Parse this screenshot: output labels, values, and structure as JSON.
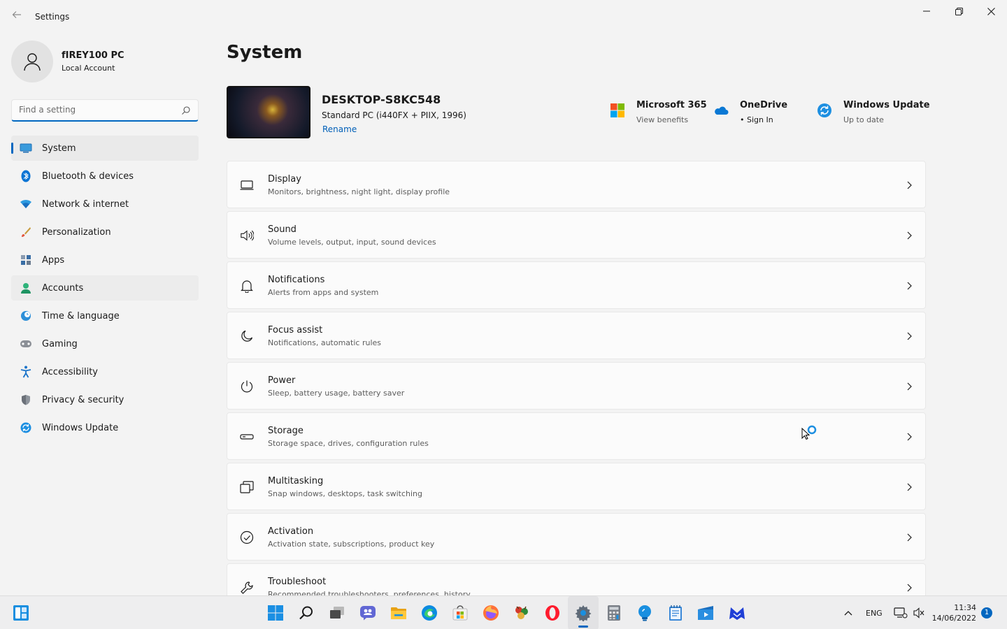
{
  "window": {
    "title": "Settings",
    "back_icon": "back-arrow-icon",
    "controls": [
      "minimize-icon",
      "maximize-icon",
      "close-icon"
    ]
  },
  "profile": {
    "name": "fIREY100 PC",
    "account_type": "Local Account"
  },
  "search": {
    "placeholder": "Find a setting",
    "value": ""
  },
  "sidebar": {
    "items": [
      {
        "label": "System",
        "icon": "monitor-icon",
        "active": true
      },
      {
        "label": "Bluetooth & devices",
        "icon": "bluetooth-icon"
      },
      {
        "label": "Network & internet",
        "icon": "wifi-icon"
      },
      {
        "label": "Personalization",
        "icon": "brush-icon"
      },
      {
        "label": "Apps",
        "icon": "apps-icon"
      },
      {
        "label": "Accounts",
        "icon": "person-icon",
        "hovered": true
      },
      {
        "label": "Time & language",
        "icon": "clock-globe-icon"
      },
      {
        "label": "Gaming",
        "icon": "gamepad-icon"
      },
      {
        "label": "Accessibility",
        "icon": "accessibility-icon"
      },
      {
        "label": "Privacy & security",
        "icon": "shield-icon"
      },
      {
        "label": "Windows Update",
        "icon": "update-icon"
      }
    ]
  },
  "main": {
    "page_title": "System",
    "device": {
      "name": "DESKTOP-S8KC548",
      "spec": "Standard PC (i440FX + PIIX, 1996)",
      "rename_label": "Rename"
    },
    "quick_links": [
      {
        "title": "Microsoft 365",
        "subtitle": "View benefits",
        "icon": "microsoft-logo-icon"
      },
      {
        "title": "OneDrive",
        "subtitle": "• Sign In",
        "icon": "onedrive-cloud-icon"
      },
      {
        "title": "Windows Update",
        "subtitle": "Up to date",
        "icon": "update-icon"
      }
    ],
    "cards": [
      {
        "title": "Display",
        "subtitle": "Monitors, brightness, night light, display profile",
        "icon": "display-icon"
      },
      {
        "title": "Sound",
        "subtitle": "Volume levels, output, input, sound devices",
        "icon": "speaker-icon"
      },
      {
        "title": "Notifications",
        "subtitle": "Alerts from apps and system",
        "icon": "bell-icon"
      },
      {
        "title": "Focus assist",
        "subtitle": "Notifications, automatic rules",
        "icon": "moon-icon"
      },
      {
        "title": "Power",
        "subtitle": "Sleep, battery usage, battery saver",
        "icon": "power-icon"
      },
      {
        "title": "Storage",
        "subtitle": "Storage space, drives, configuration rules",
        "icon": "storage-icon"
      },
      {
        "title": "Multitasking",
        "subtitle": "Snap windows, desktops, task switching",
        "icon": "multitasking-icon"
      },
      {
        "title": "Activation",
        "subtitle": "Activation state, subscriptions, product key",
        "icon": "check-circle-icon"
      },
      {
        "title": "Troubleshoot",
        "subtitle": "Recommended troubleshooters, preferences, history",
        "icon": "wrench-icon"
      }
    ]
  },
  "taskbar": {
    "apps": [
      "start-icon",
      "search-icon",
      "task-view-icon",
      "chat-icon",
      "file-explorer-icon",
      "edge-icon",
      "store-icon",
      "firefox-icon",
      "game-icon",
      "opera-icon",
      "settings-icon",
      "calculator-icon",
      "tips-icon",
      "notepad-icon",
      "media-player-icon",
      "malwarebytes-icon"
    ],
    "active_app": "settings-icon",
    "language": "ENG",
    "time": "11:34",
    "date": "14/06/2022",
    "notification_count": "1"
  },
  "colors": {
    "accent": "#0067c0",
    "link": "#005fb8",
    "background": "#f3f3f3",
    "card": "#fbfbfb"
  }
}
